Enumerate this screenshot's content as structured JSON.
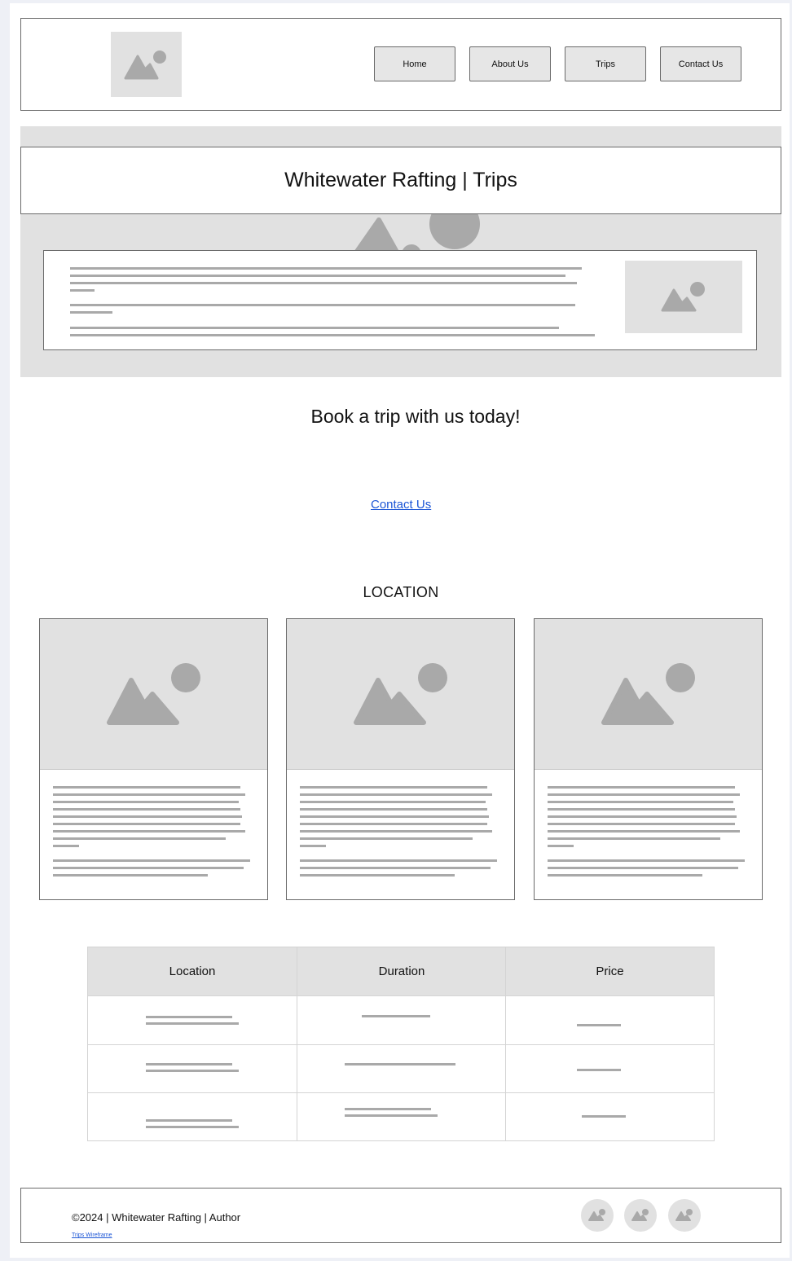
{
  "nav": {
    "items": [
      "Home",
      "About Us",
      "Trips",
      "Contact Us"
    ]
  },
  "hero": {
    "title": "Whitewater Rafting | Trips"
  },
  "cta": {
    "heading": "Book a trip with us today!",
    "link_label": "Contact Us"
  },
  "locations": {
    "heading": "LOCATION"
  },
  "table": {
    "headers": [
      "Location",
      "Duration",
      "Price"
    ]
  },
  "footer": {
    "copyright": "©2024 | Whitewater Rafting | Author",
    "link_label": "Trips Wireframe"
  },
  "colors": {
    "placeholder_fill": "#e1e1e1",
    "placeholder_glyph": "#a9a9a9",
    "link": "#1c56d6",
    "border": "#6a6a6a"
  },
  "icons": {
    "image_placeholder": "image-placeholder-icon"
  }
}
